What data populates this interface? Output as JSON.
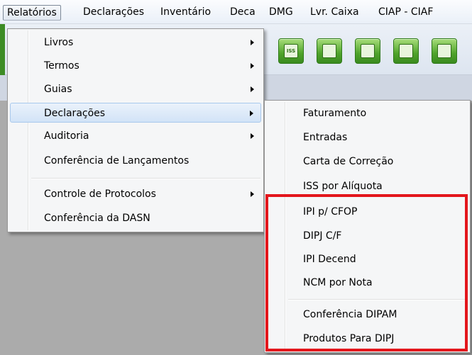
{
  "menubar": {
    "items": [
      {
        "label": "Relatórios"
      },
      {
        "label": "Declarações"
      },
      {
        "label": "Inventário"
      },
      {
        "label": "Deca"
      },
      {
        "label": "DMG"
      },
      {
        "label": "Lvr. Caixa"
      },
      {
        "label": "CIAP - CIAF"
      }
    ]
  },
  "relatorios_menu": {
    "items": [
      {
        "label": "Livros"
      },
      {
        "label": "Termos"
      },
      {
        "label": "Guias"
      },
      {
        "label": "Declarações"
      },
      {
        "label": "Auditoria"
      },
      {
        "label": "Conferência de Lançamentos"
      },
      {
        "label": "Controle de Protocolos"
      },
      {
        "label": "Conferência da DASN"
      }
    ]
  },
  "declaracoes_submenu": {
    "items": [
      {
        "label": "Faturamento"
      },
      {
        "label": "Entradas"
      },
      {
        "label": "Carta de Correção"
      },
      {
        "label": "ISS por Alíquota"
      },
      {
        "label": "IPI p/ CFOP"
      },
      {
        "label": "DIPJ C/F"
      },
      {
        "label": "IPI Decend"
      },
      {
        "label": "NCM por Nota"
      },
      {
        "label": "Conferência DIPAM"
      },
      {
        "label": "Produtos Para DIPJ"
      }
    ]
  },
  "toolbar": {
    "iss_label": "ISS"
  },
  "colors": {
    "highlight_box": "#e3161c",
    "toolbar_button": "#4fa32b"
  }
}
